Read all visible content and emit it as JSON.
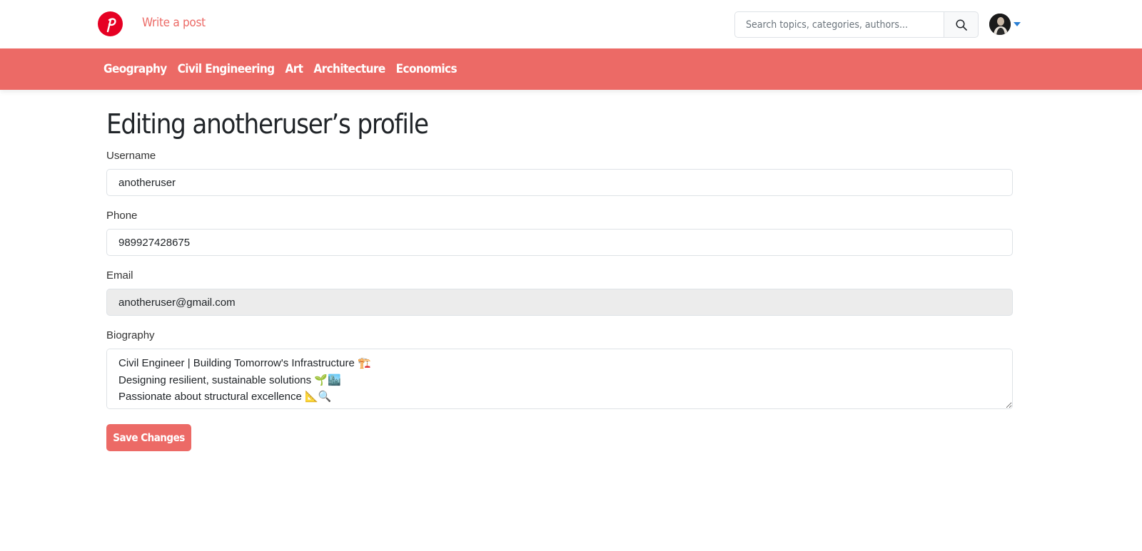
{
  "header": {
    "logo_letter": "P",
    "write_post_label": "Write a post",
    "search_placeholder": "Search topics, categories, authors...",
    "search_icon": "search-icon",
    "avatar": "user-avatar"
  },
  "categories": [
    {
      "label": "Geography"
    },
    {
      "label": "Civil Engineering"
    },
    {
      "label": "Art"
    },
    {
      "label": "Architecture"
    },
    {
      "label": "Economics"
    }
  ],
  "form": {
    "title": "Editing anotheruser’s profile",
    "username_label": "Username",
    "username_value": "anotheruser",
    "phone_label": "Phone",
    "phone_value": "989927428675",
    "email_label": "Email",
    "email_value": "anotheruser@gmail.com",
    "bio_label": "Biography",
    "bio_value": "Civil Engineer | Building Tomorrow's Infrastructure 🏗️\nDesigning resilient, sustainable solutions 🌱🏙️\nPassionate about structural excellence 📐🔍",
    "save_label": "Save Changes"
  },
  "colors": {
    "brand": "#ec6a66",
    "logo_red": "#e60023",
    "caret_blue": "#2a7fd4"
  }
}
